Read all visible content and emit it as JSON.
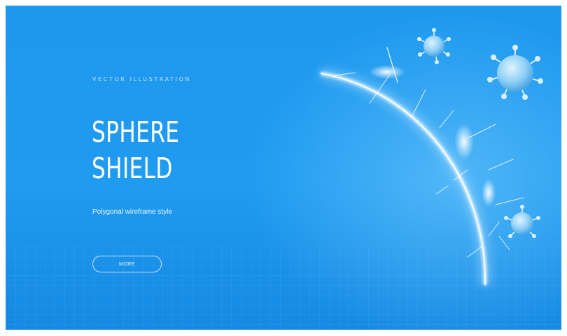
{
  "banner": {
    "eyebrow": "VECTOR ILLUSTRATION",
    "title_line1": "SPHERE",
    "title_line2": "SHIELD",
    "subtitle": "Polygonal wireframe style",
    "button_label": "MORE"
  },
  "colors": {
    "background": "#1f9bf0",
    "text": "#ffffff"
  },
  "icons": [
    "sphere-shield-illustration",
    "virus-icon"
  ]
}
